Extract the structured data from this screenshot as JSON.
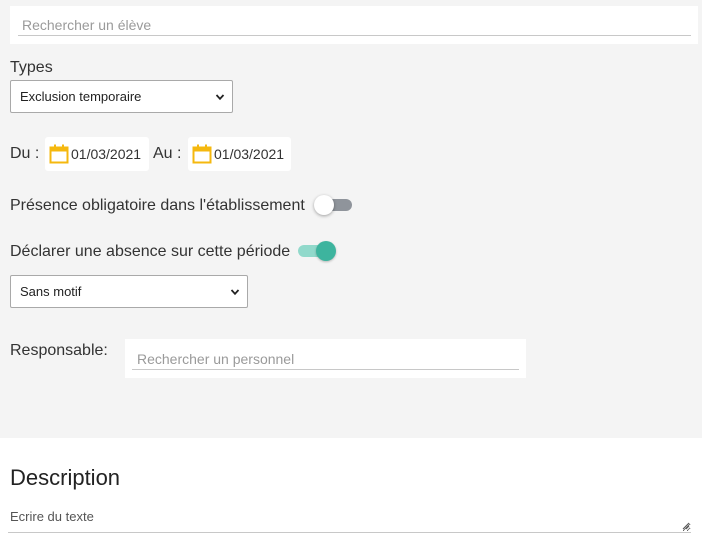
{
  "search": {
    "placeholder": "Rechercher un élève"
  },
  "types": {
    "label": "Types",
    "selected": "Exclusion temporaire"
  },
  "period": {
    "from_label": "Du :",
    "from_date": "01/03/2021",
    "to_label": "Au :",
    "to_date": "01/03/2021"
  },
  "presence": {
    "label": "Présence obligatoire dans l'établissement",
    "enabled": false
  },
  "absence": {
    "label": "Déclarer une absence sur cette période",
    "enabled": true,
    "motif_selected": "Sans motif"
  },
  "responsable": {
    "label": "Responsable:",
    "placeholder": "Rechercher un personnel"
  },
  "description": {
    "title": "Description",
    "placeholder": "Ecrire du texte"
  },
  "colors": {
    "panel_bg": "#f4f4f4",
    "calendar_icon": "#f5b80f",
    "toggle_on": "#3db49e",
    "toggle_off": "#8f949b"
  }
}
